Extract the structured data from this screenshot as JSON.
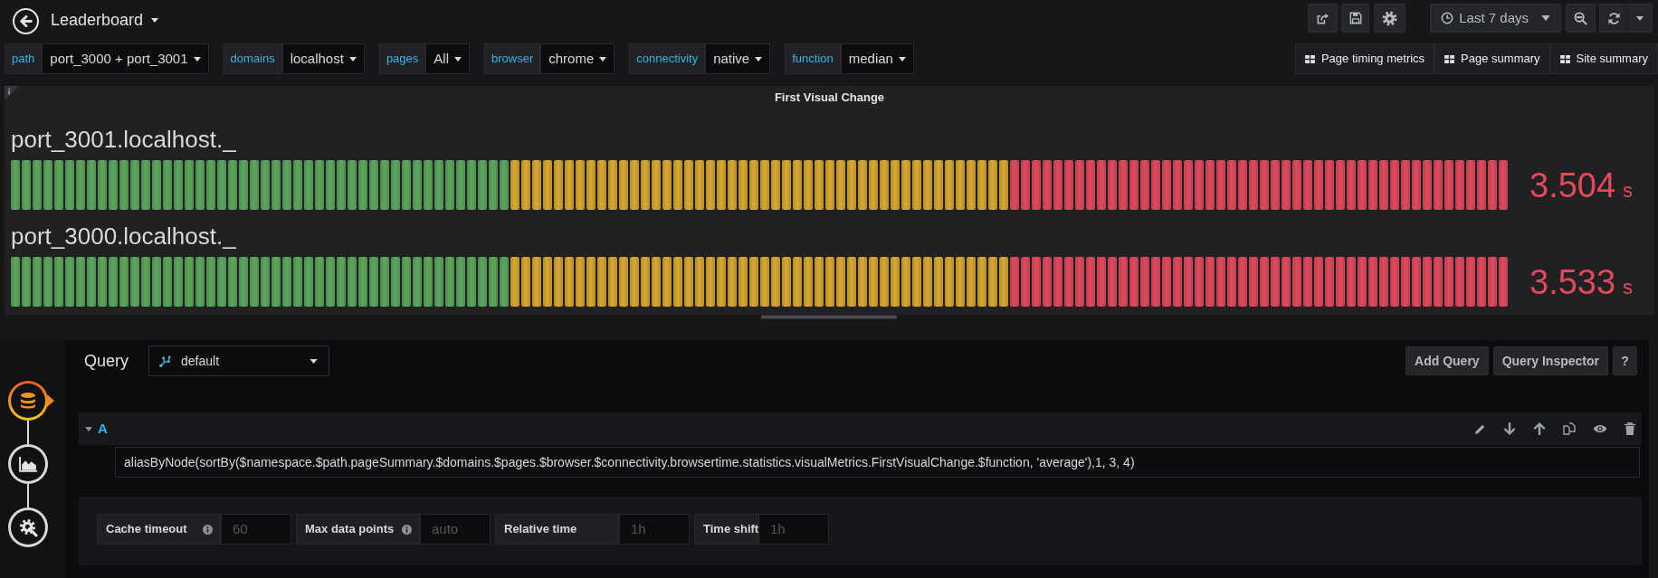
{
  "navbar": {
    "title": "Leaderboard",
    "time_range": "Last 7 days"
  },
  "variables": [
    {
      "label": "path",
      "value": "port_3000 + port_3001"
    },
    {
      "label": "domains",
      "value": "localhost"
    },
    {
      "label": "pages",
      "value": "All"
    },
    {
      "label": "browser",
      "value": "chrome"
    },
    {
      "label": "connectivity",
      "value": "native"
    },
    {
      "label": "function",
      "value": "median"
    }
  ],
  "dashboard_links": [
    "Page timing metrics",
    "Page summary",
    "Site summary"
  ],
  "panel": {
    "title": "First Visual Change",
    "gauges": [
      {
        "name": "port_3001.localhost._",
        "level": 1,
        "value": "3.504",
        "unit": "s"
      },
      {
        "name": "port_3000.localhost._",
        "level": 1,
        "value": "3.533",
        "unit": "s"
      }
    ]
  },
  "query_editor": {
    "steps": [
      {
        "kind": "queries",
        "selected": true
      },
      {
        "kind": "visualization",
        "selected": false
      },
      {
        "kind": "general",
        "selected": false
      }
    ],
    "title": "Query",
    "datasource": "default",
    "buttons": [
      "Add Query",
      "Query Inspector",
      "?"
    ],
    "queries": [
      {
        "ref": "A",
        "expanded": true,
        "target": "aliasByNode(sortBy($namespace.$path.pageSummary.$domains.$pages.$browser.$connectivity.browsertime.statistics.visualMetrics.FirstVisualChange.$function, 'average'),1, 3, 4)"
      }
    ],
    "options": [
      {
        "label": "Cache timeout",
        "info": true,
        "placeholder": "60"
      },
      {
        "label": "Max data points",
        "info": true,
        "placeholder": "auto"
      },
      {
        "label": "Relative time",
        "info": false,
        "placeholder": "1h"
      },
      {
        "label": "Time shift",
        "info": false,
        "placeholder": "1h"
      }
    ]
  }
}
